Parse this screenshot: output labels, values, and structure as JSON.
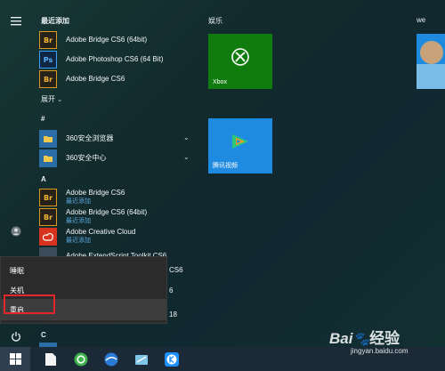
{
  "recent": {
    "header": "最近添加",
    "items": [
      {
        "label": "Adobe Bridge CS6 (64bit)",
        "icon": "Br"
      },
      {
        "label": "Adobe Photoshop CS6 (64 Bit)",
        "icon": "Ps"
      },
      {
        "label": "Adobe Bridge CS6",
        "icon": "Br"
      }
    ],
    "expand_label": "展开"
  },
  "list": {
    "hash_header": "#",
    "hash_items": [
      {
        "label": "360安全浏览器"
      },
      {
        "label": "360安全中心"
      }
    ],
    "a_header": "A",
    "a_items": [
      {
        "label": "Adobe Bridge CS6",
        "sub": "最近添加",
        "icon": "Br"
      },
      {
        "label": "Adobe Bridge CS6 (64bit)",
        "sub": "最近添加",
        "icon": "Br"
      },
      {
        "label": "Adobe Creative Cloud",
        "sub": "最近添加",
        "icon": "Cc"
      },
      {
        "label": "Adobe ExtendScript Toolkit CS6",
        "sub": "",
        "icon": "Es"
      }
    ],
    "partial_tails": [
      "CS6",
      "6",
      "18"
    ],
    "c_header": "C"
  },
  "tiles": {
    "entertainment_header": "娱乐",
    "we_header": "we",
    "xbox_label": "Xbox",
    "tencent_label": "腾讯视频"
  },
  "power_menu": {
    "sleep": "睡眠",
    "shutdown": "关机",
    "restart": "重启"
  },
  "watermark": {
    "brand": "Bai",
    "suffix": "经验",
    "url": "jingyan.baidu.com"
  },
  "colors": {
    "xbox_tile": "#107c10",
    "tencent_tile": "#1e8ae0",
    "highlight": "#e5262d",
    "accent_text": "#5aa7d9"
  }
}
